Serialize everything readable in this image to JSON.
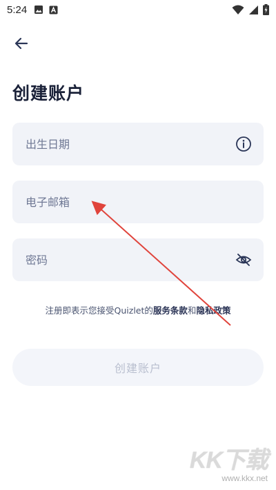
{
  "status_bar": {
    "time": "5:24",
    "left_icons": [
      "image-icon",
      "a-app-icon"
    ],
    "right_icons": [
      "wifi-icon",
      "signal-icon",
      "battery-charging-icon"
    ]
  },
  "header": {
    "back_icon": "arrow-left-icon",
    "title": "创建账户"
  },
  "form": {
    "dob": {
      "placeholder": "出生日期",
      "value": "",
      "trail_icon": "info-icon"
    },
    "email": {
      "placeholder": "电子邮箱",
      "value": ""
    },
    "password": {
      "placeholder": "密码",
      "value": "",
      "trail_icon": "eye-off-icon"
    }
  },
  "terms": {
    "prefix": "注册即表示您接受Quizlet的",
    "terms_link": "服务条款",
    "conjunction": "和",
    "privacy_link": "隐私政策"
  },
  "submit": {
    "label": "创建账户",
    "enabled": false
  },
  "watermark": {
    "logo": "KK下载",
    "url": "www.kkx.net"
  },
  "colors": {
    "field_bg": "#f1f3f8",
    "title": "#1a2138",
    "placeholder": "#6f7894",
    "button_disabled_text": "#b9bfcf",
    "annotation_arrow": "#e0443c"
  }
}
